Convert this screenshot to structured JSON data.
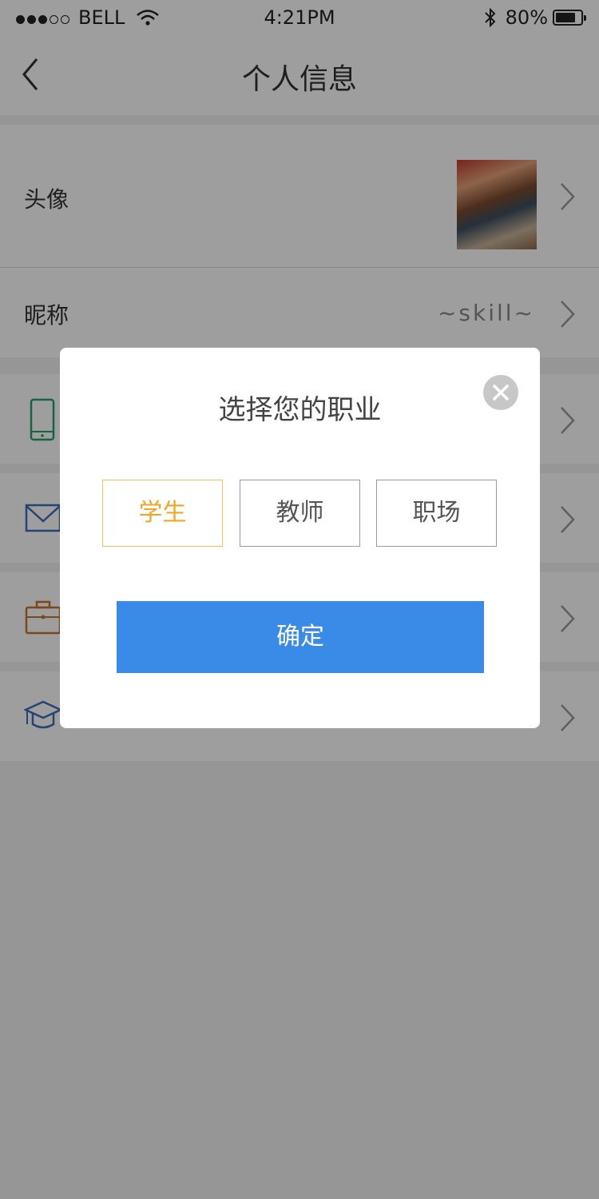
{
  "status_bar": {
    "carrier": "BELL",
    "time": "4:21PM",
    "battery_percent": "80%",
    "battery_level": 0.8
  },
  "nav": {
    "title": "个人信息"
  },
  "rows": {
    "avatar": {
      "label": "头像"
    },
    "nickname": {
      "label": "昵称",
      "value": "~skill~"
    }
  },
  "icons": {
    "phone_color": "#27a06b",
    "mail_color": "#3a6fb7",
    "briefcase_color": "#c9742a",
    "graduation_color": "#3a6fb7"
  },
  "modal": {
    "title": "选择您的职业",
    "options": [
      {
        "label": "学生",
        "selected": true
      },
      {
        "label": "教师",
        "selected": false
      },
      {
        "label": "职场",
        "selected": false
      }
    ],
    "confirm_label": "确定",
    "accent_selected": "#f2a623",
    "confirm_color": "#3a8ae8"
  }
}
